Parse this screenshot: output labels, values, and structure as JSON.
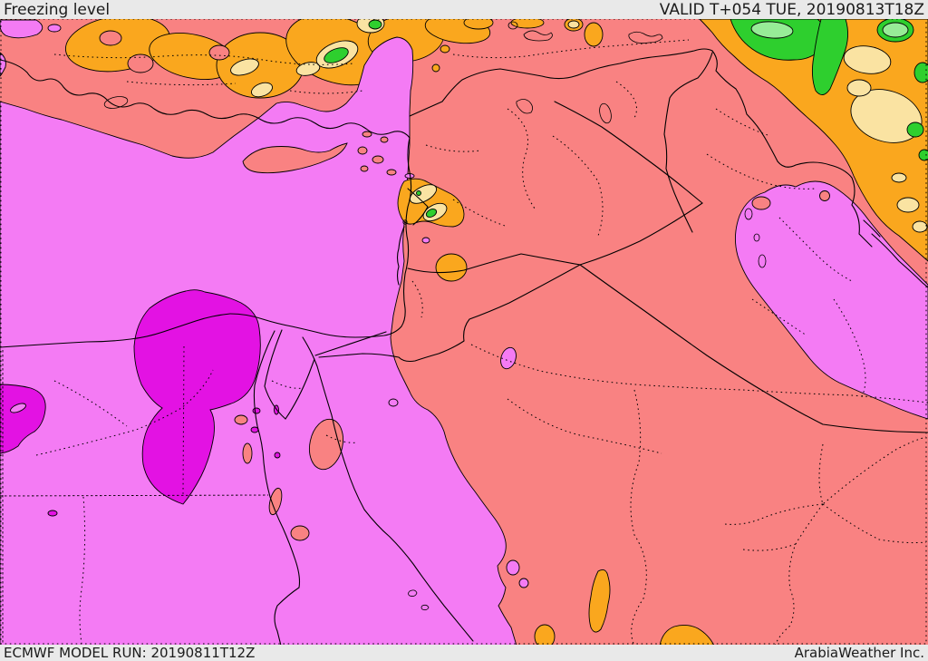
{
  "header": {
    "title": "Freezing level",
    "valid": "VALID T+054 TUE, 20190813T18Z"
  },
  "footer": {
    "model_run": "ECMWF MODEL RUN: 20190811T12Z",
    "brand": "ArabiaWeather Inc."
  },
  "colors": {
    "bar_bg": "#e9e9e9",
    "bar_text": "#1b1b1b",
    "salmon": "#F98282",
    "violet": "#F47BF4",
    "magenta": "#E312E3",
    "orange": "#FAA71E",
    "cream": "#FAE3A2",
    "green": "#2ECF2E",
    "light_green": "#97EC97",
    "line": "#000000"
  }
}
